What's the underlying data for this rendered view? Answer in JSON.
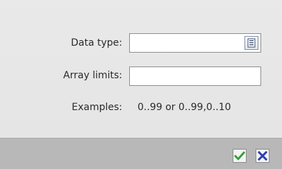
{
  "form": {
    "data_type": {
      "label": "Data type:",
      "value": "",
      "placeholder": "",
      "list_icon": "list-select-icon"
    },
    "array_limits": {
      "label": "Array limits:",
      "value": "",
      "placeholder": ""
    },
    "examples": {
      "label": "Examples:",
      "value": "0..99 or 0..99,0..10"
    }
  },
  "footer": {
    "confirm_icon": "checkmark-icon",
    "cancel_icon": "close-icon"
  },
  "colors": {
    "confirm_green": "#35a03a",
    "cancel_blue": "#2a3fb0",
    "footer_bg": "#b8b8b8",
    "dialog_bg": "#e8e8e8"
  }
}
